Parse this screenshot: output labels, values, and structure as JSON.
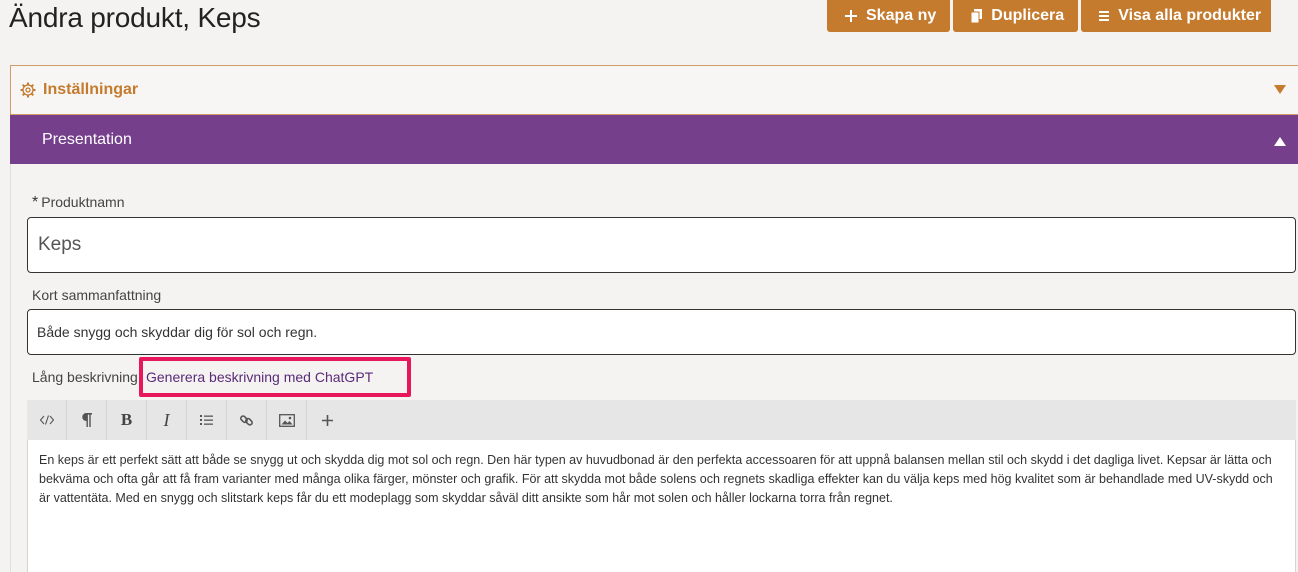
{
  "page": {
    "title": "Ändra produkt, Keps"
  },
  "toolbar": {
    "create_label": "Skapa ny",
    "duplicate_label": "Duplicera",
    "show_all_label": "Visa alla produkter"
  },
  "settings": {
    "label": "Inställningar"
  },
  "presentation": {
    "label": "Presentation"
  },
  "form": {
    "name": {
      "required_mark": "*",
      "label": "Produktnamn",
      "value": "Keps"
    },
    "summary": {
      "label": "Kort sammanfattning",
      "value": "Både snygg och skyddar dig för sol och regn."
    },
    "long_description": {
      "label": "Lång beskrivning",
      "gpt_link": "Generera beskrivning med ChatGPT",
      "value": "En keps är ett perfekt sätt att både se snygg ut och skydda dig mot sol och regn. Den här typen av huvudbonad är den perfekta accessoaren för att uppnå balansen mellan stil och skydd i det dagliga livet. Kepsar är lätta och bekväma och ofta går att få fram varianter med många olika färger, mönster och grafik. För att skydda mot både solens och regnets skadliga effekter kan du välja keps med hög kvalitet som är behandlade med UV-skydd och är vattentäta. Med en snygg och slitstark keps får du ett modeplagg som skyddar såväl ditt ansikte som hår mot solen och håller lockarna torra från regnet."
    }
  },
  "editor_tools": [
    "code-view-icon",
    "paragraph-icon",
    "bold-icon",
    "italic-icon",
    "list-icon",
    "link-icon",
    "image-icon",
    "plus-icon"
  ],
  "colors": {
    "accent": "#c47b2e",
    "presentation_bar": "#763f8c",
    "highlight": "#e8175d"
  }
}
